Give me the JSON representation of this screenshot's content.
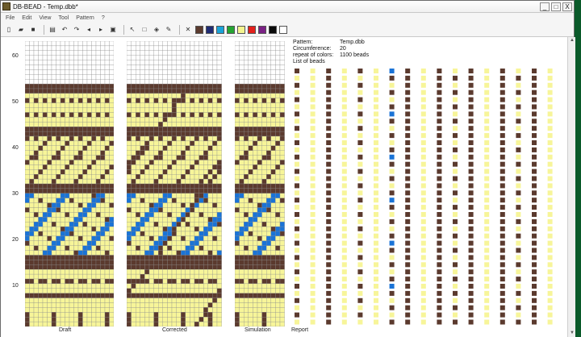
{
  "window": {
    "title": "DB-BEAD - Temp.dbb*",
    "minimize": "_",
    "maximize": "□",
    "close": "X"
  },
  "menu": [
    "File",
    "Edit",
    "View",
    "Tool",
    "Pattern",
    "?"
  ],
  "toolbar": {
    "tools": [
      "new-icon",
      "open-icon",
      "save-icon",
      "print-icon",
      "undo-icon",
      "redo-icon",
      "arrow-left-icon",
      "arrow-right-icon",
      "copy-icon",
      "pointer-icon",
      "select-rect-icon",
      "fill-icon",
      "pipette-icon",
      "clear-icon"
    ],
    "colors": [
      "#5b3a2e",
      "#1f2b73",
      "#1aa3d8",
      "#25a532",
      "#f4f48f",
      "#e3201b",
      "#7a2184",
      "#0a0a0a",
      "#ffffff"
    ]
  },
  "ruler": {
    "labels": [
      "60",
      "50",
      "40",
      "30",
      "20",
      "10"
    ]
  },
  "panels": {
    "draft": "Draft",
    "corrected": "Corrected",
    "simulation": "Simulation",
    "report": "Report"
  },
  "report": {
    "pattern_label": "Pattern:",
    "pattern_value": "Temp.dbb",
    "circumference_label": "Circumference:",
    "circumference_value": "20",
    "repeat_label": "repeat of colors:",
    "repeat_value": "1100 beads",
    "list_label": "List of beads"
  },
  "pattern_colors": {
    "brown": "#5b3a2e",
    "yellow": "#f7f599",
    "blue": "#1a73d6",
    "empty": "#ffffff",
    "grid": "#8a8a8a"
  }
}
